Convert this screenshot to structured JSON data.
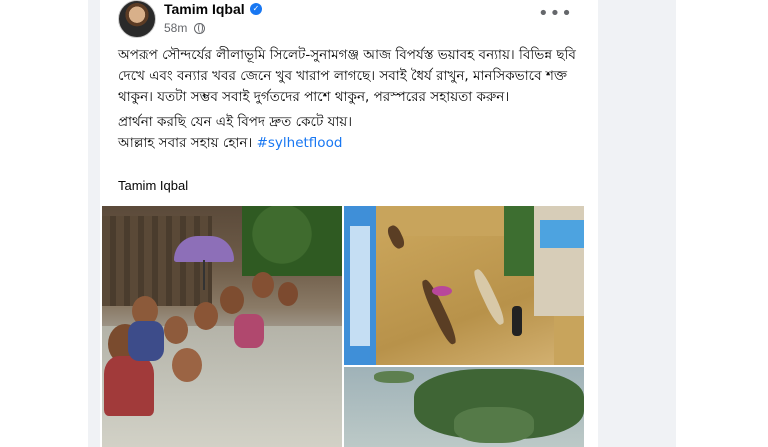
{
  "post": {
    "author": "Tamim Iqbal",
    "verified_icon": "verified-badge-icon",
    "time": "58m",
    "more_icon": "more-options-icon",
    "more_label": "•••",
    "paragraphs": [
      "অপরূপ সৌন্দর্যের লীলাভূমি সিলেট-সুনামগঞ্জ আজ বিপর্যস্ত ভয়াবহ বন্যায়। বিভিন্ন ছবি দেখে এবং বন্যার খবর জেনে খুব খারাপ লাগছে। সবাই ধৈর্য রাখুন, মানসিকভাবে শক্ত থাকুন। যতটা সম্ভব সবাই দুর্গতদের পাশে থাকুন, পরস্পরের সহায়তা করুন।",
      "প্রার্থনা করছি যেন এই বিপদ দ্রুত কেটে যায়।"
    ],
    "last_line": "আল্লাহ সবার সহায় হোন।",
    "hashtag": "#sylhetflood",
    "signature": "Tamim Iqbal"
  },
  "colors": {
    "link": "#1877f2",
    "secondary_text": "#65676b",
    "page_bg": "#f0f2f5"
  }
}
